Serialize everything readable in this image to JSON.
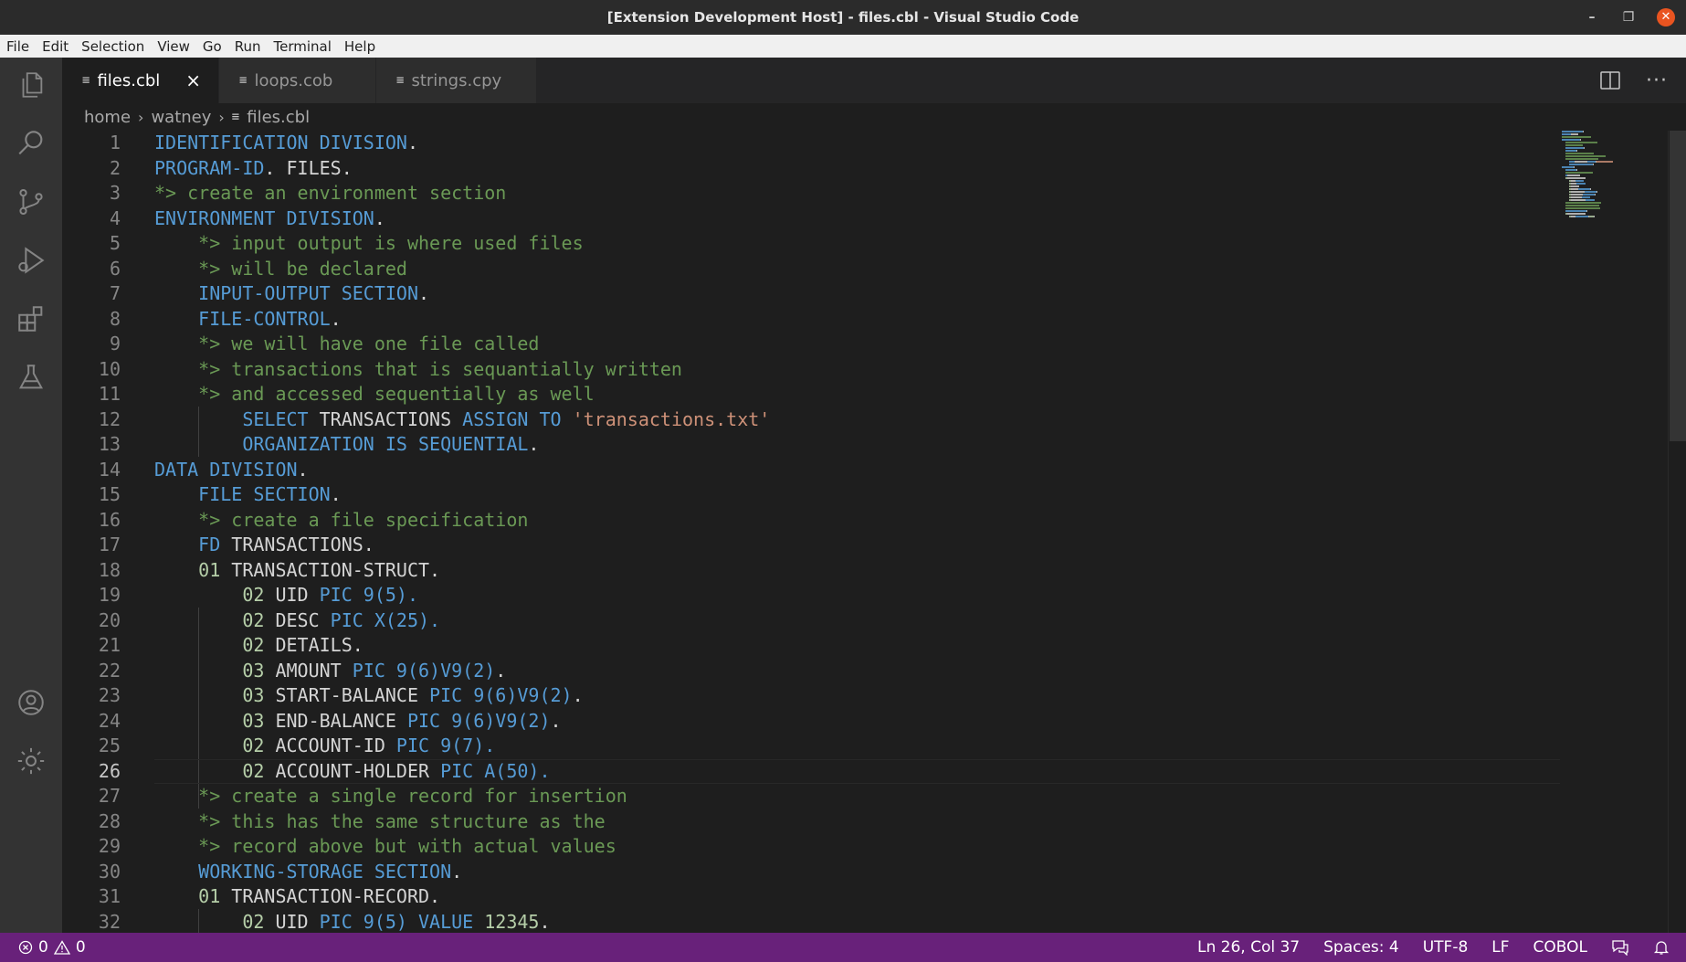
{
  "window": {
    "title": "[Extension Development Host] - files.cbl - Visual Studio Code"
  },
  "menu": [
    "File",
    "Edit",
    "Selection",
    "View",
    "Go",
    "Run",
    "Terminal",
    "Help"
  ],
  "activity_bar": {
    "top": [
      "files-icon",
      "search-icon",
      "source-control-icon",
      "run-debug-icon",
      "extensions-icon",
      "testing-icon"
    ],
    "bottom": [
      "account-icon",
      "settings-gear-icon"
    ]
  },
  "tabs": [
    {
      "label": "files.cbl",
      "active": true
    },
    {
      "label": "loops.cob",
      "active": false
    },
    {
      "label": "strings.cpy",
      "active": false
    }
  ],
  "breadcrumb": [
    "home",
    "watney",
    "files.cbl"
  ],
  "editor": {
    "current_line": 26,
    "lines": [
      {
        "n": "1",
        "indent": 0,
        "tokens": [
          [
            "k",
            "IDENTIFICATION DIVISION"
          ],
          [
            "t",
            "."
          ]
        ]
      },
      {
        "n": "2",
        "indent": 0,
        "tokens": [
          [
            "k",
            "PROGRAM-ID"
          ],
          [
            "t",
            ". FILES."
          ]
        ]
      },
      {
        "n": "3",
        "indent": 0,
        "tokens": [
          [
            "c",
            "*> create an environment section"
          ]
        ]
      },
      {
        "n": "4",
        "indent": 0,
        "tokens": [
          [
            "k",
            "ENVIRONMENT DIVISION"
          ],
          [
            "t",
            "."
          ]
        ]
      },
      {
        "n": "5",
        "indent": 1,
        "tokens": [
          [
            "c",
            "*> input output is where used files"
          ]
        ]
      },
      {
        "n": "6",
        "indent": 1,
        "tokens": [
          [
            "c",
            "*> will be declared"
          ]
        ]
      },
      {
        "n": "7",
        "indent": 1,
        "tokens": [
          [
            "k",
            "INPUT-OUTPUT SECTION"
          ],
          [
            "t",
            "."
          ]
        ]
      },
      {
        "n": "8",
        "indent": 1,
        "tokens": [
          [
            "k",
            "FILE-CONTROL"
          ],
          [
            "t",
            "."
          ]
        ]
      },
      {
        "n": "9",
        "indent": 1,
        "tokens": [
          [
            "c",
            "*> we will have one file called"
          ]
        ]
      },
      {
        "n": "10",
        "indent": 1,
        "tokens": [
          [
            "c",
            "*> transactions that is sequantially written"
          ]
        ]
      },
      {
        "n": "11",
        "indent": 1,
        "tokens": [
          [
            "c",
            "*> and accessed sequentially as well"
          ]
        ]
      },
      {
        "n": "12",
        "indent": 2,
        "tokens": [
          [
            "k",
            "SELECT"
          ],
          [
            "t",
            " TRANSACTIONS "
          ],
          [
            "k",
            "ASSIGN TO"
          ],
          [
            "t",
            " "
          ],
          [
            "s",
            "'transactions.txt'"
          ]
        ]
      },
      {
        "n": "13",
        "indent": 2,
        "tokens": [
          [
            "k",
            "ORGANIZATION IS SEQUENTIAL"
          ],
          [
            "t",
            "."
          ]
        ]
      },
      {
        "n": "14",
        "indent": 0,
        "tokens": [
          [
            "k",
            "DATA DIVISION"
          ],
          [
            "t",
            "."
          ]
        ]
      },
      {
        "n": "15",
        "indent": 1,
        "tokens": [
          [
            "k",
            "FILE SECTION"
          ],
          [
            "t",
            "."
          ]
        ]
      },
      {
        "n": "16",
        "indent": 1,
        "tokens": [
          [
            "c",
            "*> create a file specification"
          ]
        ]
      },
      {
        "n": "17",
        "indent": 1,
        "tokens": [
          [
            "k",
            "FD"
          ],
          [
            "t",
            " TRANSACTIONS."
          ]
        ]
      },
      {
        "n": "18",
        "indent": 1,
        "tokens": [
          [
            "n",
            "01"
          ],
          [
            "t",
            " TRANSACTION-STRUCT."
          ]
        ]
      },
      {
        "n": "19",
        "indent": 2,
        "tokens": [
          [
            "n",
            "02"
          ],
          [
            "t",
            " UID "
          ],
          [
            "k",
            "PIC 9(5)."
          ]
        ]
      },
      {
        "n": "20",
        "indent": 2,
        "tokens": [
          [
            "n",
            "02"
          ],
          [
            "t",
            " DESC "
          ],
          [
            "k",
            "PIC X(25)."
          ]
        ]
      },
      {
        "n": "21",
        "indent": 2,
        "tokens": [
          [
            "n",
            "02"
          ],
          [
            "t",
            " DETAILS."
          ]
        ]
      },
      {
        "n": "22",
        "indent": 2,
        "tokens": [
          [
            "n",
            "03"
          ],
          [
            "t",
            " AMOUNT "
          ],
          [
            "k",
            "PIC 9(6)V9(2)"
          ],
          [
            "t",
            "."
          ]
        ]
      },
      {
        "n": "23",
        "indent": 2,
        "tokens": [
          [
            "n",
            "03"
          ],
          [
            "t",
            " START-BALANCE "
          ],
          [
            "k",
            "PIC 9(6)V9(2)"
          ],
          [
            "t",
            "."
          ]
        ]
      },
      {
        "n": "24",
        "indent": 2,
        "tokens": [
          [
            "n",
            "03"
          ],
          [
            "t",
            " END-BALANCE "
          ],
          [
            "k",
            "PIC 9(6)V9(2)"
          ],
          [
            "t",
            "."
          ]
        ]
      },
      {
        "n": "25",
        "indent": 2,
        "tokens": [
          [
            "n",
            "02"
          ],
          [
            "t",
            " ACCOUNT-ID "
          ],
          [
            "k",
            "PIC 9(7)."
          ]
        ]
      },
      {
        "n": "26",
        "indent": 2,
        "tokens": [
          [
            "n",
            "02"
          ],
          [
            "t",
            " ACCOUNT-HOLDER "
          ],
          [
            "k",
            "PIC A(50)."
          ]
        ]
      },
      {
        "n": "27",
        "indent": 1,
        "tokens": [
          [
            "c",
            "*> create a single record for insertion"
          ]
        ]
      },
      {
        "n": "28",
        "indent": 1,
        "tokens": [
          [
            "c",
            "*> this has the same structure as the"
          ]
        ]
      },
      {
        "n": "29",
        "indent": 1,
        "tokens": [
          [
            "c",
            "*> record above but with actual values"
          ]
        ]
      },
      {
        "n": "30",
        "indent": 1,
        "tokens": [
          [
            "k",
            "WORKING-STORAGE SECTION"
          ],
          [
            "t",
            "."
          ]
        ]
      },
      {
        "n": "31",
        "indent": 1,
        "tokens": [
          [
            "n",
            "01"
          ],
          [
            "t",
            " TRANSACTION-RECORD."
          ]
        ]
      },
      {
        "n": "32",
        "indent": 2,
        "tokens": [
          [
            "n",
            "02"
          ],
          [
            "t",
            " UID "
          ],
          [
            "k",
            "PIC 9(5) VALUE"
          ],
          [
            "t",
            " "
          ],
          [
            "n",
            "12345"
          ],
          [
            "t",
            "."
          ]
        ]
      }
    ]
  },
  "status": {
    "errors": "0",
    "warnings": "0",
    "position": "Ln 26, Col 37",
    "spaces": "Spaces: 4",
    "encoding": "UTF-8",
    "eol": "LF",
    "language": "COBOL"
  },
  "colors": {
    "statusbar": "#68217a",
    "keyword": "#569cd6",
    "comment": "#6a9955",
    "string": "#ce9178",
    "number": "#b5cea8"
  }
}
